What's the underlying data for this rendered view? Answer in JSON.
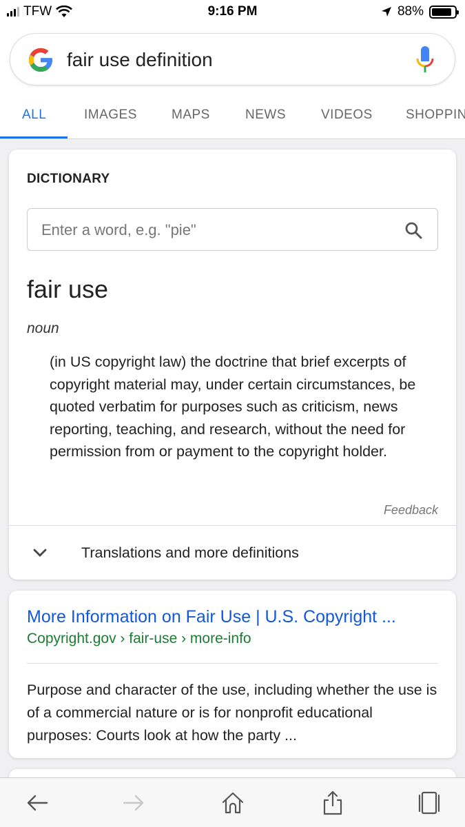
{
  "status_bar": {
    "carrier": "TFW",
    "time": "9:16 PM",
    "battery": "88%",
    "battery_level": 0.88
  },
  "search": {
    "query": "fair use definition"
  },
  "tabs": [
    {
      "label": "ALL",
      "active": true
    },
    {
      "label": "IMAGES"
    },
    {
      "label": "MAPS"
    },
    {
      "label": "NEWS"
    },
    {
      "label": "VIDEOS"
    },
    {
      "label": "SHOPPIN"
    }
  ],
  "dictionary": {
    "title": "DICTIONARY",
    "input_placeholder": "Enter a word, e.g. \"pie\"",
    "word": "fair use",
    "part_of_speech": "noun",
    "definition": "(in US copyright law) the doctrine that brief excerpts of copyright material may, under certain circumstances, be quoted verbatim for purposes such as criticism, news reporting, teaching, and research, without the need for permission from or payment to the copyright holder.",
    "feedback": "Feedback",
    "more_label": "Translations and more definitions"
  },
  "result": {
    "title": "More Information on Fair Use | U.S. Copyright ...",
    "url": "Copyright.gov › fair-use › more-info",
    "snippet": "Purpose and character of the use, including whether the use is of a commercial nature or is for nonprofit educational purposes: Courts look at how the party ..."
  },
  "toolbar": {
    "icons": [
      "back-icon",
      "forward-icon",
      "home-icon",
      "share-icon",
      "tabs-icon"
    ]
  },
  "colors": {
    "accent": "#1a73e8",
    "link": "#1558d6",
    "url_green": "#1e7b34"
  }
}
